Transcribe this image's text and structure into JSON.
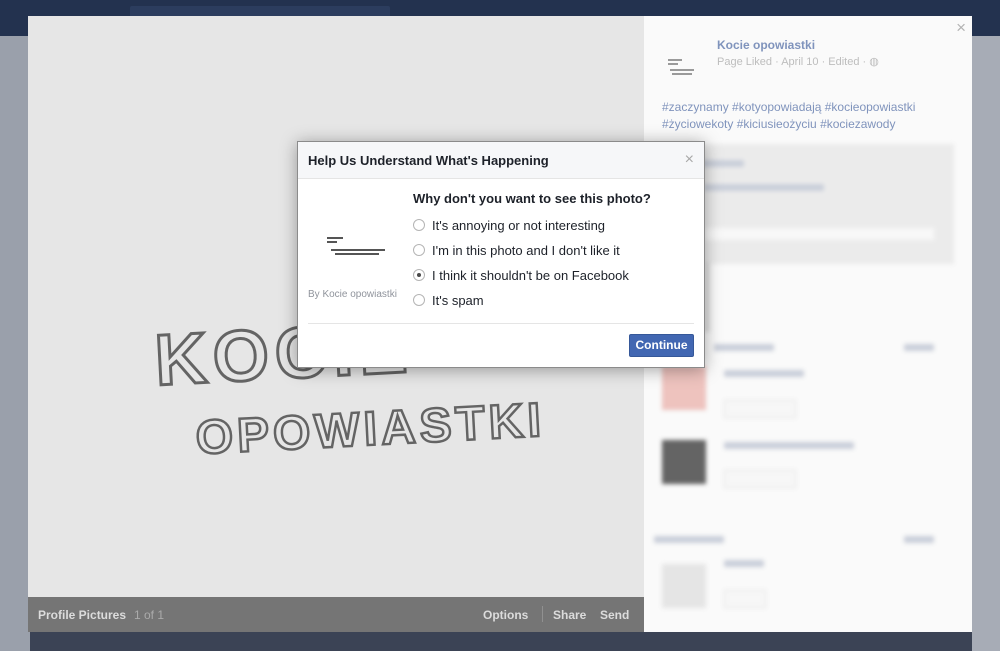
{
  "dialog": {
    "title": "Help Us Understand What's Happening",
    "close_glyph": "×",
    "question": "Why don't you want to see this photo?",
    "by_line": "By Kocie opowiastki",
    "options": [
      {
        "label": "It's annoying or not interesting",
        "selected": false
      },
      {
        "label": "I'm in this photo and I don't like it",
        "selected": false
      },
      {
        "label": "I think it shouldn't be on Facebook",
        "selected": true
      },
      {
        "label": "It's spam",
        "selected": false
      }
    ],
    "continue_label": "Continue"
  },
  "sidebar": {
    "close_glyph": "×",
    "page_name": "Kocie opowiastki",
    "page_meta": "Page Liked · April 10 · Edited · ◍",
    "hashtags": "#zaczynamy #kotyopowiadają #kocieopowiastki #życiowekoty #kiciusieożyciu #kociezawody"
  },
  "photo_bar": {
    "album": "Profile Pictures",
    "count": "1 of 1",
    "options": "Options",
    "share": "Share",
    "send": "Send"
  },
  "photo": {
    "line1": "KOCIE",
    "line2": "OPOWIASTKI"
  },
  "icons": {
    "close": "close-icon",
    "privacy": "globe-icon"
  },
  "colors": {
    "link": "#3b5998",
    "button": "#4267b2",
    "photo_bar": "#2b2b2b"
  }
}
